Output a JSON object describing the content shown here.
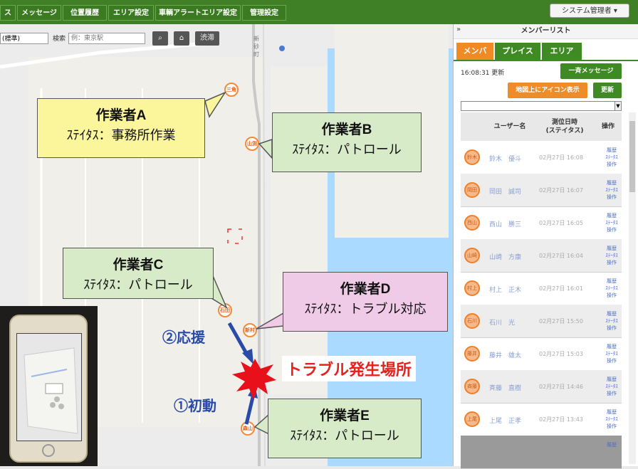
{
  "nav": {
    "tabs": [
      "ス",
      "メッセージ",
      "位置履歴",
      "エリア設定",
      "車輌アラートエリア設定",
      "管理設定"
    ],
    "admin_button": "システム管理者 ▾"
  },
  "map": {
    "select_value": "(標準)",
    "search_label": "検索",
    "search_placeholder": "例：東京駅",
    "search_button": "⌕",
    "home_button": "⌂",
    "zoom_button": "渋滞",
    "place_label": "新砂町",
    "pins": [
      "三角",
      "山渕",
      "石田",
      "新村",
      "森山"
    ],
    "callouts": [
      {
        "name": "作業者A",
        "status": "ｽﾃｲﾀｽ：事務所作業"
      },
      {
        "name": "作業者B",
        "status": "ｽﾃｲﾀｽ：パトロール"
      },
      {
        "name": "作業者C",
        "status": "ｽﾃｲﾀｽ：パトロール"
      },
      {
        "name": "作業者D",
        "status": "ｽﾃｲﾀｽ：トラブル対応"
      },
      {
        "name": "作業者E",
        "status": "ｽﾃｲﾀｽ：パトロール"
      }
    ],
    "support_label": "②応援",
    "first_label": "①初動",
    "trouble_label": "トラブル発生場所"
  },
  "panel": {
    "collapse": "»",
    "title": "メンバーリスト",
    "tabs": [
      "メンバ",
      "プレイス",
      "エリア"
    ],
    "time": "16:08:31 更新",
    "broadcast_button": "一斉メッセージ",
    "show_icons_button": "地図上にアイコン表示",
    "refresh_button": "更新",
    "table": {
      "headers": [
        "ユーザー名",
        "測位日時\n(ステイタス)",
        "操作"
      ],
      "rows": [
        {
          "avatar": "鈴木",
          "name": "鈴木　優斗",
          "date": "02月27日 16:08",
          "ops": "履歴\nｽﾃｰﾀｽ\n操作"
        },
        {
          "avatar": "岡田",
          "name": "岡田　誠司",
          "date": "02月27日 16:07",
          "ops": "履歴\nｽﾃｰﾀｽ\n操作"
        },
        {
          "avatar": "西山",
          "name": "西山　勝三",
          "date": "02月27日 16:05",
          "ops": "履歴\nｽﾃｰﾀｽ\n操作"
        },
        {
          "avatar": "山崎",
          "name": "山崎　方康",
          "date": "02月27日 16:04",
          "ops": "履歴\nｽﾃｰﾀｽ\n操作"
        },
        {
          "avatar": "村上",
          "name": "村上　正木",
          "date": "02月27日 16:01",
          "ops": "履歴\nｽﾃｰﾀｽ\n操作"
        },
        {
          "avatar": "石川",
          "name": "石川　光",
          "date": "02月27日 15:50",
          "ops": "履歴\nｽﾃｰﾀｽ\n操作"
        },
        {
          "avatar": "藤井",
          "name": "藤井　雄太",
          "date": "02月27日 15:03",
          "ops": "履歴\nｽﾃｰﾀｽ\n操作"
        },
        {
          "avatar": "斉藤",
          "name": "斉藤　直樹",
          "date": "02月27日 14:46",
          "ops": "履歴\nｽﾃｰﾀｽ\n操作"
        },
        {
          "avatar": "上尾",
          "name": "上尾　正孝",
          "date": "02月27日 13:43",
          "ops": "履歴\nｽﾃｰﾀｽ\n操作"
        },
        {
          "avatar": "",
          "name": "",
          "date": "",
          "ops": "履歴"
        }
      ]
    }
  }
}
